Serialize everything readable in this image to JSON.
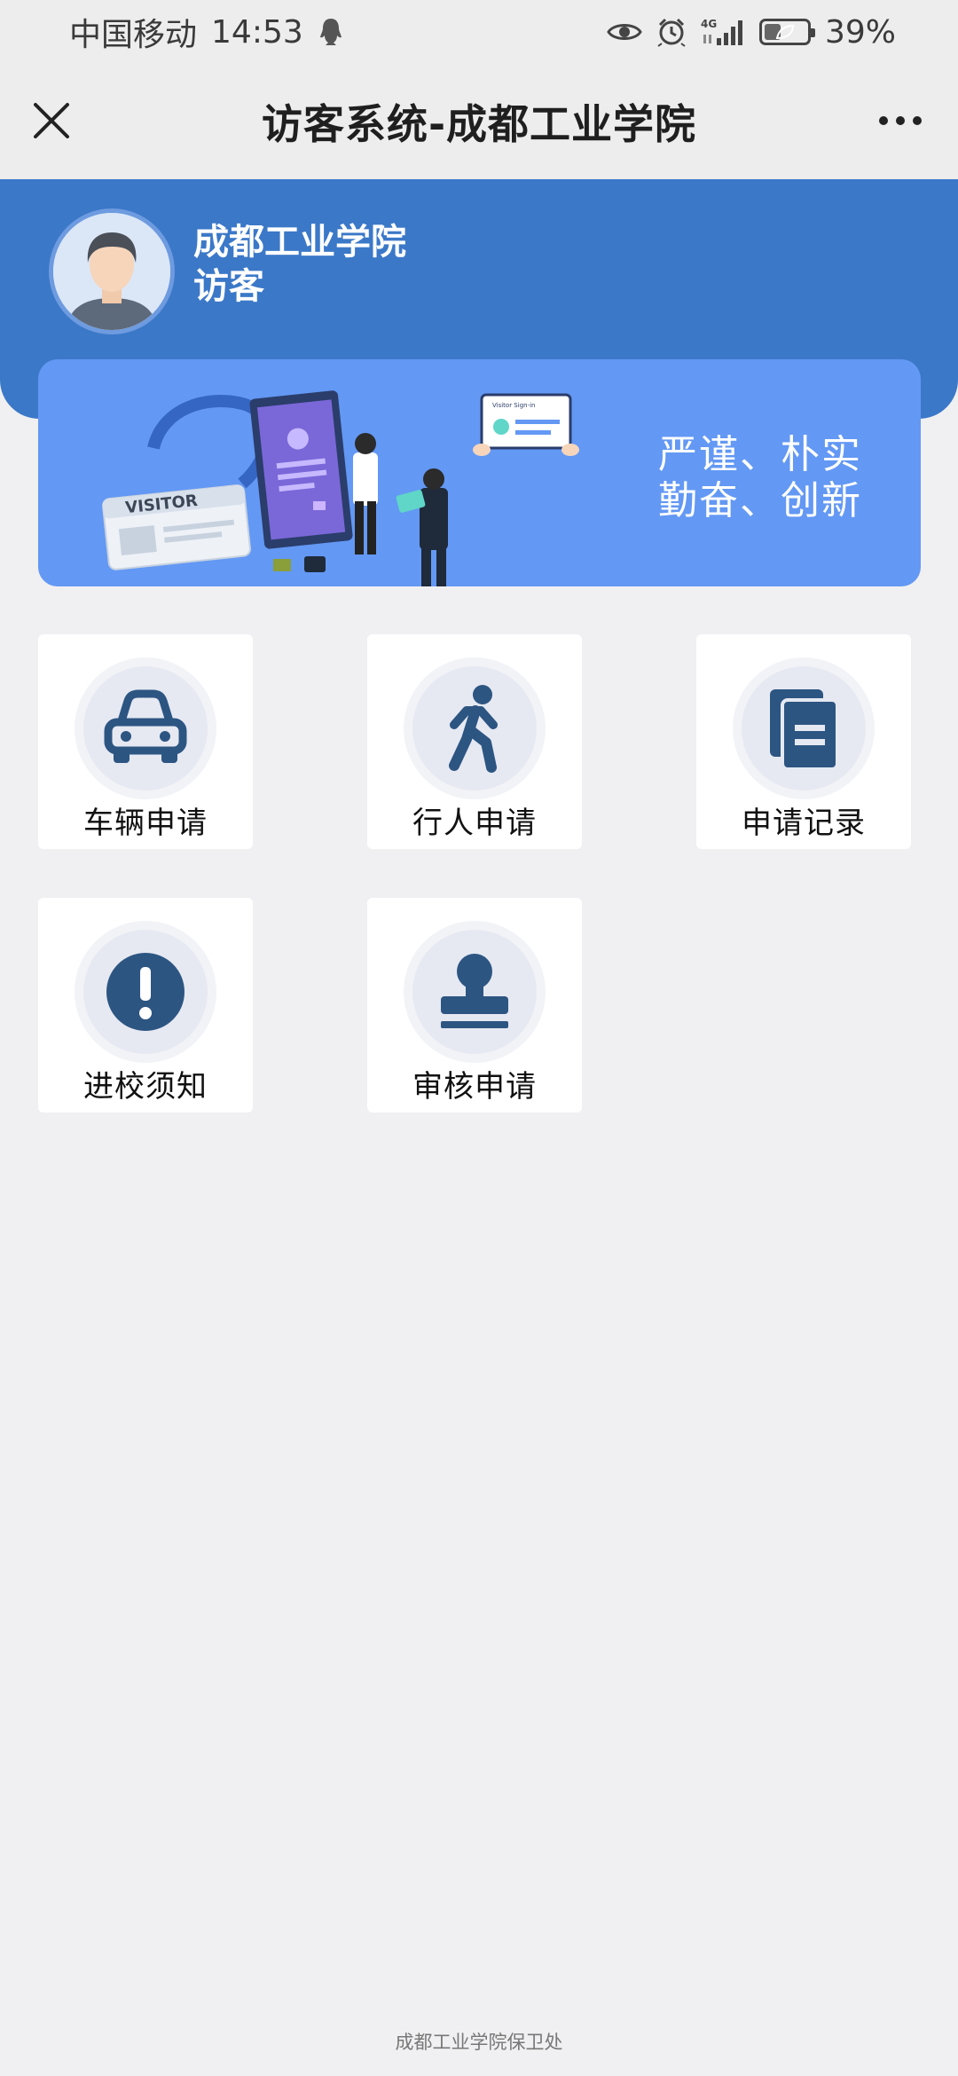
{
  "status_bar": {
    "carrier": "中国移动",
    "time": "14:53",
    "network": "4G",
    "battery": "39%",
    "battery_level": 0.39
  },
  "title_bar": {
    "title": "访客系统-成都工业学院"
  },
  "header": {
    "org_name": "成都工业学院",
    "role": "访客"
  },
  "banner": {
    "badge_text": "VISITOR",
    "screen_text": "Visitor Sign-in",
    "slogan_line1": "严谨、朴实",
    "slogan_line2": "勤奋、创新"
  },
  "menu": {
    "vehicle_apply": "车辆申请",
    "pedestrian_apply": "行人申请",
    "apply_records": "申请记录",
    "entry_notice": "进校须知",
    "review_apply": "审核申请"
  },
  "footer": {
    "text": "成都工业学院保卫处"
  },
  "colors": {
    "header_blue": "#3b78c8",
    "banner_blue": "#6398f4",
    "icon_navy": "#2d5582",
    "background": "#f0f0f2"
  }
}
